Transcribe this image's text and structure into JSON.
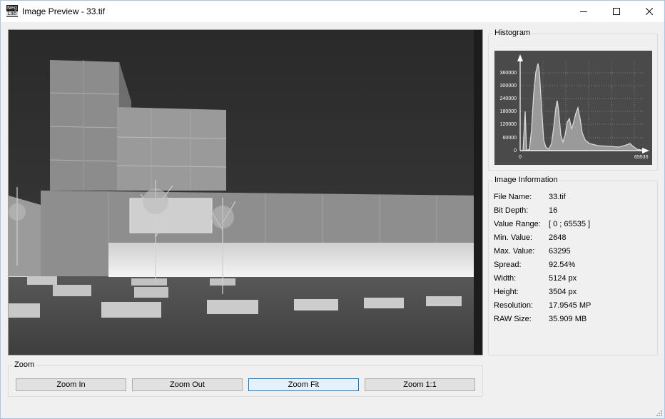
{
  "window": {
    "title": "Image Preview - 33.tif",
    "app_icon_text": [
      "Neg",
      "Lab"
    ],
    "icons": {
      "minimize": "minimize-icon",
      "maximize": "maximize-icon",
      "close": "close-icon"
    }
  },
  "histogram": {
    "title": "Histogram",
    "y_ticks": [
      "360000",
      "300000",
      "240000",
      "180000",
      "120000",
      "60000",
      "0"
    ],
    "x_ticks": [
      "0",
      "65535"
    ],
    "colors": {
      "background": "#4a4a4a",
      "curve": "#c8c8c8",
      "grid": "#8a8a8a"
    }
  },
  "info": {
    "title": "Image Information",
    "rows": [
      {
        "label": "File Name:",
        "value": "33.tif"
      },
      {
        "label": "Bit Depth:",
        "value": "16"
      },
      {
        "label": "Value Range:",
        "value": "[ 0 ; 65535 ]"
      },
      {
        "label": "Min. Value:",
        "value": "2648"
      },
      {
        "label": "Max. Value:",
        "value": "63295"
      },
      {
        "label": "Spread:",
        "value": "92.54%"
      },
      {
        "label": "Width:",
        "value": "5124 px"
      },
      {
        "label": "Height:",
        "value": "3504 px"
      },
      {
        "label": "Resolution:",
        "value": "17.9545 MP"
      },
      {
        "label": "RAW Size:",
        "value": "35.909 MB"
      }
    ]
  },
  "zoom": {
    "title": "Zoom",
    "buttons": [
      "Zoom In",
      "Zoom Out",
      "Zoom Fit",
      "Zoom 1:1"
    ],
    "active": "Zoom Fit"
  }
}
